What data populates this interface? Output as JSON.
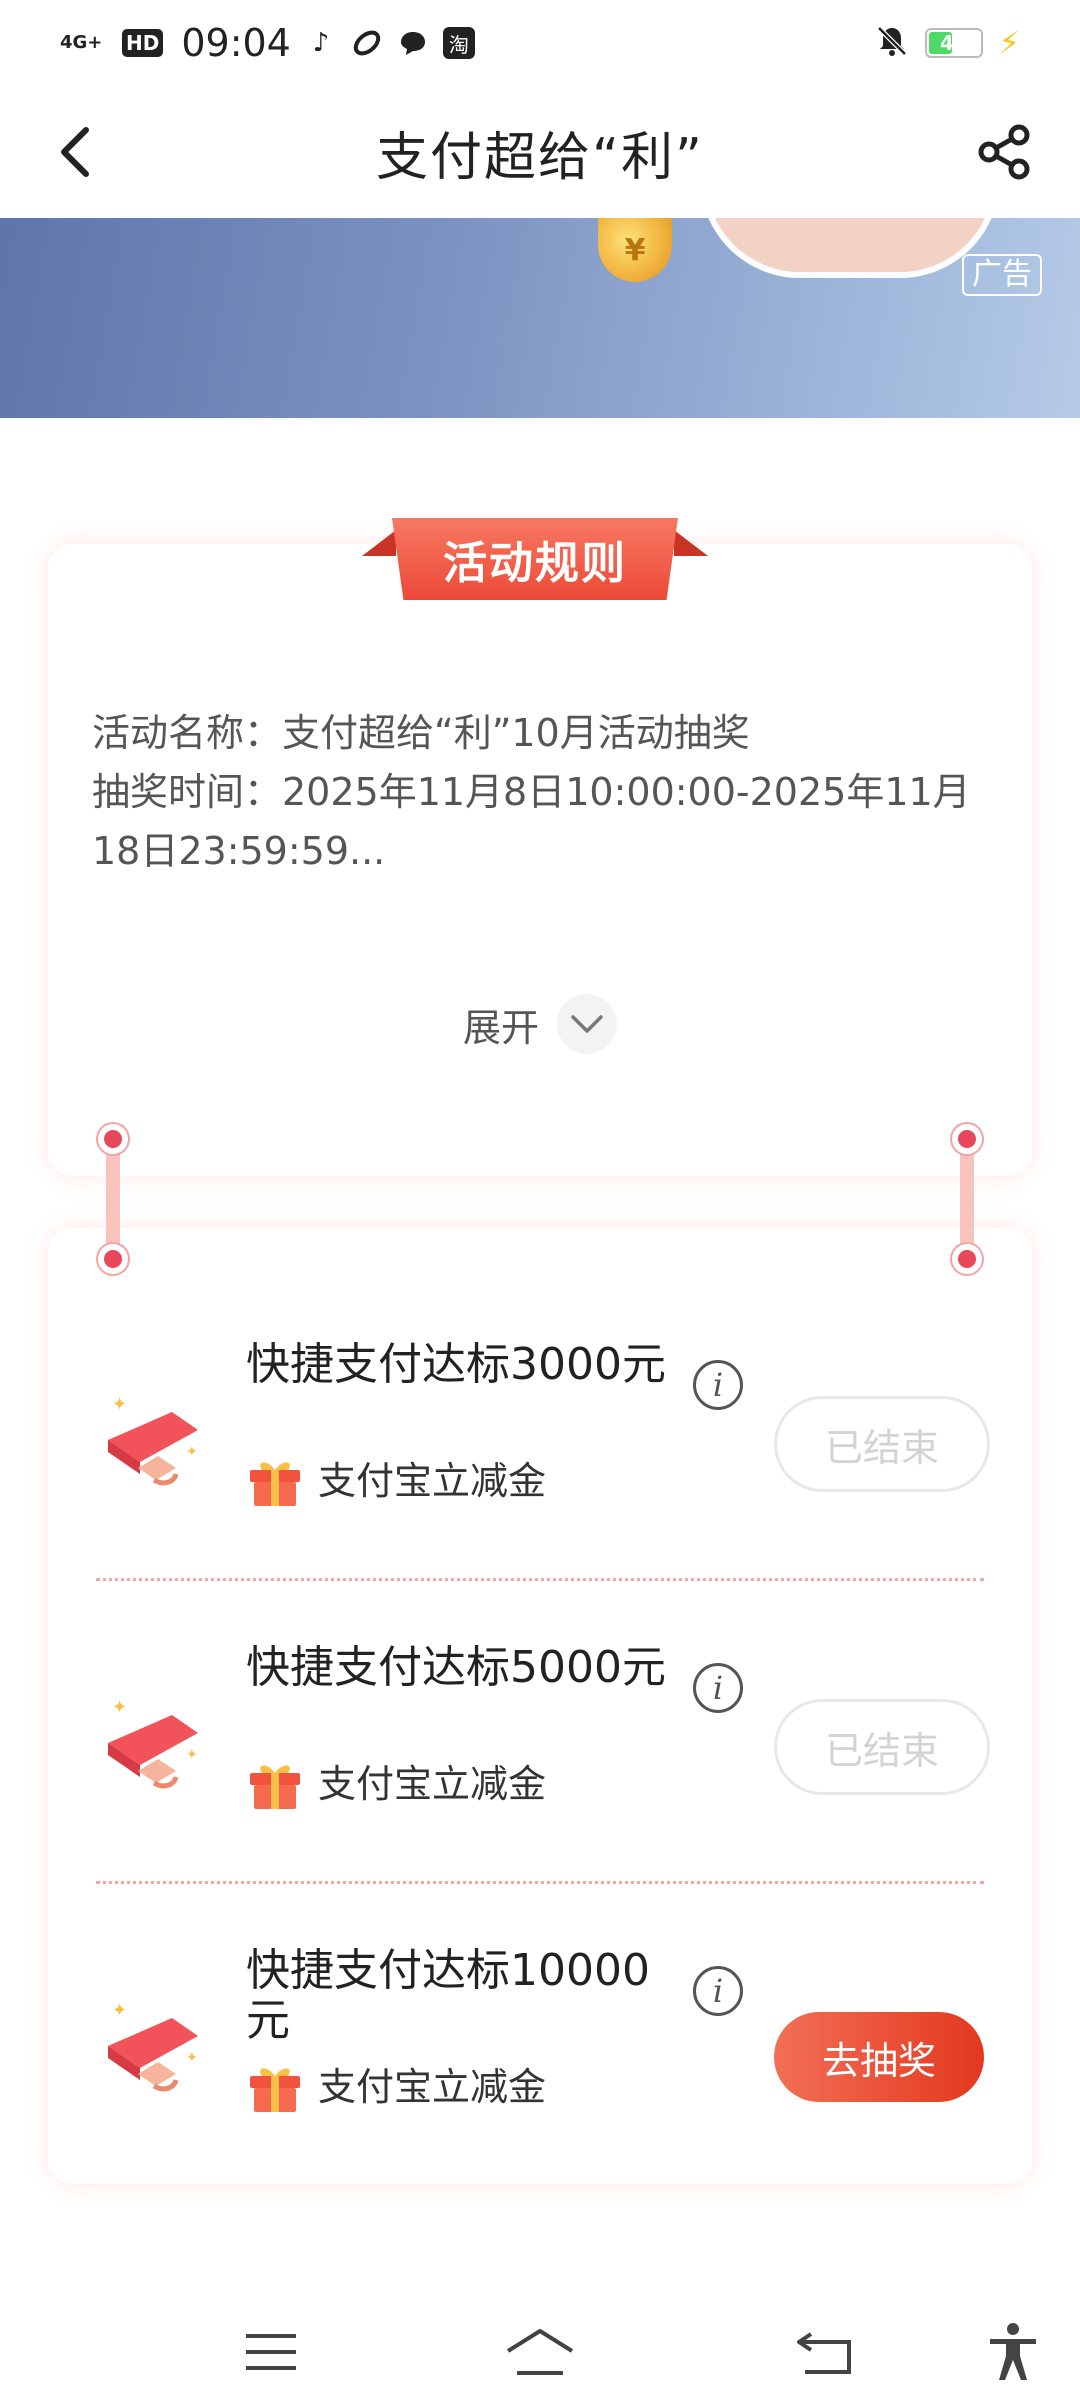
{
  "status_bar": {
    "network": "4G+",
    "hd": "HD",
    "time": "09:04",
    "taobao_label": "淘",
    "battery": "45",
    "battery_level": 0.45
  },
  "header": {
    "title": "支付超给“利”",
    "back_icon": "back-chevron-icon",
    "share_icon": "share-icon"
  },
  "banner": {
    "ad_label": "广告",
    "coin_symbol": "¥"
  },
  "rules": {
    "tab_label": "活动规则",
    "line1": "活动名称：支付超给“利”10月活动抽奖",
    "line2": "抽奖时间：2025年11月8日10:00:00-2025年11月18日23:59:59...",
    "expand_label": "展开"
  },
  "tasks": [
    {
      "title": "快捷支付达标3000元",
      "subtitle": "支付宝立减金",
      "button": "已结束",
      "status": "ended"
    },
    {
      "title": "快捷支付达标5000元",
      "subtitle": "支付宝立减金",
      "button": "已结束",
      "status": "ended"
    },
    {
      "title": "快捷支付达标10000元",
      "subtitle": "支付宝立减金",
      "button": "去抽奖",
      "status": "active"
    }
  ],
  "info_glyph": "i",
  "colors": {
    "accent": "#e9452e",
    "accent_light": "#f77862",
    "disabled_text": "#d3d3d3",
    "banner_blue": "#6f87b8"
  },
  "bottom_nav": [
    "menu-icon",
    "home-icon",
    "back-icon",
    "accessibility-icon"
  ]
}
